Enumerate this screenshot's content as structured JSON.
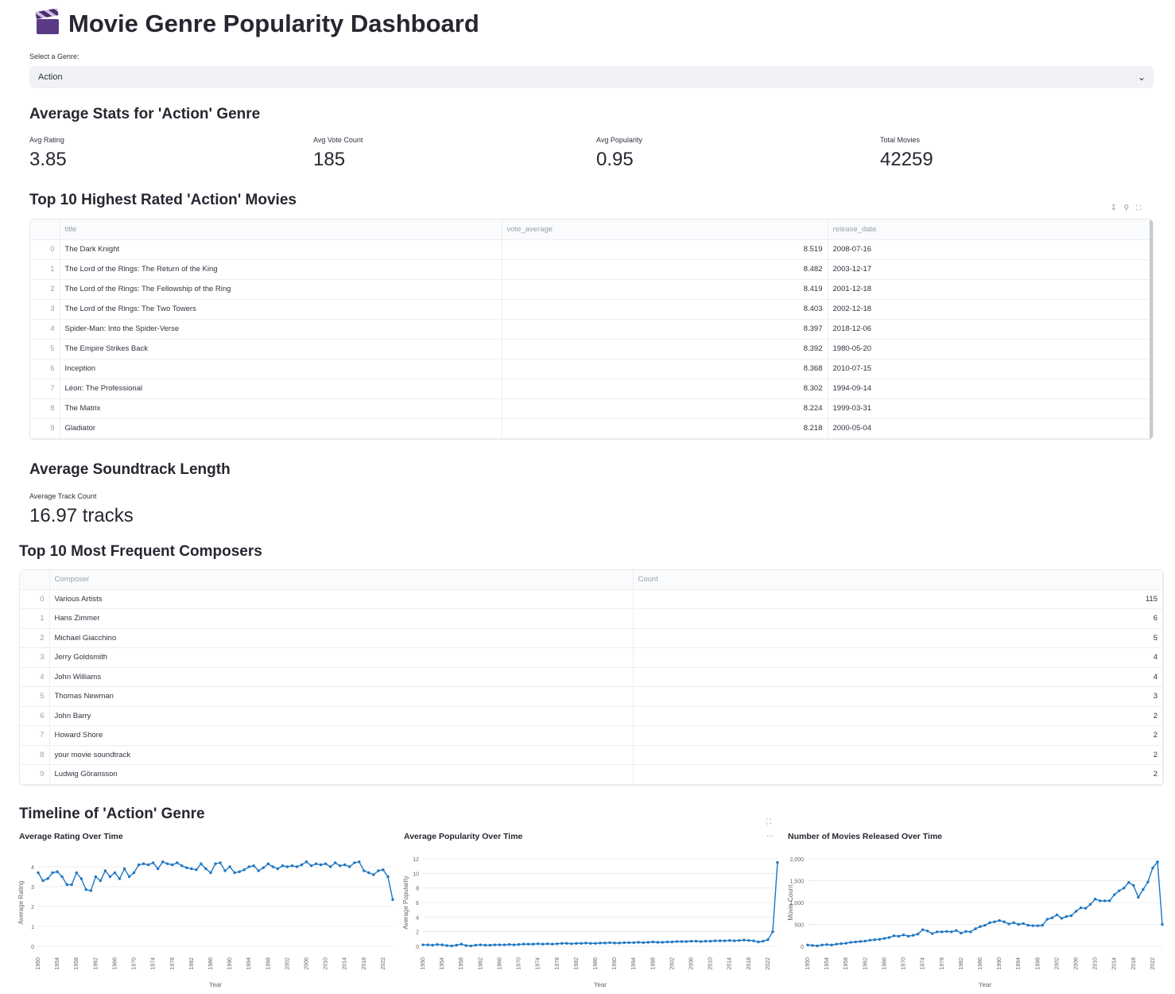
{
  "app": {
    "title": "Movie Genre Popularity Dashboard",
    "title_icon": "clapperboard-icon"
  },
  "genre_select": {
    "label": "Select a Genre:",
    "value": "Action"
  },
  "stats": {
    "heading": "Average Stats for 'Action' Genre",
    "metrics": [
      {
        "label": "Avg Rating",
        "value": "3.85"
      },
      {
        "label": "Avg Vote Count",
        "value": "185"
      },
      {
        "label": "Avg Popularity",
        "value": "0.95"
      },
      {
        "label": "Total Movies",
        "value": "42259"
      }
    ]
  },
  "top_movies": {
    "heading": "Top 10 Highest Rated 'Action' Movies",
    "toolbar_icons": [
      "download-icon",
      "search-icon",
      "fullscreen-icon"
    ],
    "columns": [
      "title",
      "vote_average",
      "release_date"
    ],
    "rows": [
      {
        "idx": "0",
        "title": "The Dark Knight",
        "vote_average": "8.519",
        "release_date": "2008-07-16"
      },
      {
        "idx": "1",
        "title": "The Lord of the Rings: The Return of the King",
        "vote_average": "8.482",
        "release_date": "2003-12-17"
      },
      {
        "idx": "2",
        "title": "The Lord of the Rings: The Fellowship of the Ring",
        "vote_average": "8.419",
        "release_date": "2001-12-18"
      },
      {
        "idx": "3",
        "title": "The Lord of the Rings: The Two Towers",
        "vote_average": "8.403",
        "release_date": "2002-12-18"
      },
      {
        "idx": "4",
        "title": "Spider-Man: Into the Spider-Verse",
        "vote_average": "8.397",
        "release_date": "2018-12-06"
      },
      {
        "idx": "5",
        "title": "The Empire Strikes Back",
        "vote_average": "8.392",
        "release_date": "1980-05-20"
      },
      {
        "idx": "6",
        "title": "Inception",
        "vote_average": "8.368",
        "release_date": "2010-07-15"
      },
      {
        "idx": "7",
        "title": "Léon: The Professional",
        "vote_average": "8.302",
        "release_date": "1994-09-14"
      },
      {
        "idx": "8",
        "title": "The Matrix",
        "vote_average": "8.224",
        "release_date": "1999-03-31"
      },
      {
        "idx": "9",
        "title": "Gladiator",
        "vote_average": "8.218",
        "release_date": "2000-05-04"
      }
    ]
  },
  "soundtrack": {
    "heading": "Average Soundtrack Length",
    "metric_label": "Average Track Count",
    "metric_value": "16.97 tracks"
  },
  "composers": {
    "heading": "Top 10 Most Frequent Composers",
    "columns": [
      "Composer",
      "Count"
    ],
    "rows": [
      {
        "idx": "0",
        "composer": "Various Artists",
        "count": "115"
      },
      {
        "idx": "1",
        "composer": "Hans Zimmer",
        "count": "6"
      },
      {
        "idx": "2",
        "composer": "Michael Giacchino",
        "count": "5"
      },
      {
        "idx": "3",
        "composer": "Jerry Goldsmith",
        "count": "4"
      },
      {
        "idx": "4",
        "composer": "John Williams",
        "count": "4"
      },
      {
        "idx": "5",
        "composer": "Thomas Newman",
        "count": "3"
      },
      {
        "idx": "6",
        "composer": "John Barry",
        "count": "2"
      },
      {
        "idx": "7",
        "composer": "Howard Shore",
        "count": "2"
      },
      {
        "idx": "8",
        "composer": "your movie soundtrack",
        "count": "2"
      },
      {
        "idx": "9",
        "composer": "Ludwig Göransson",
        "count": "2"
      }
    ]
  },
  "timeline": {
    "heading": "Timeline of 'Action' Genre",
    "line_color": "#1f77c4"
  },
  "chart_data": [
    {
      "type": "line",
      "title": "Average Rating Over Time",
      "xlabel": "Year",
      "ylabel": "Average Rating",
      "xlim": [
        1950,
        2024
      ],
      "ylim": [
        0,
        4.4
      ],
      "yticks": [
        0,
        1,
        2,
        3,
        4
      ],
      "xticks": [
        1950,
        1954,
        1958,
        1962,
        1966,
        1970,
        1974,
        1978,
        1982,
        1986,
        1990,
        1994,
        1998,
        2002,
        2006,
        2010,
        2014,
        2018,
        2022
      ],
      "x": [
        1950,
        1951,
        1952,
        1953,
        1954,
        1955,
        1956,
        1957,
        1958,
        1959,
        1960,
        1961,
        1962,
        1963,
        1964,
        1965,
        1966,
        1967,
        1968,
        1969,
        1970,
        1971,
        1972,
        1973,
        1974,
        1975,
        1976,
        1977,
        1978,
        1979,
        1980,
        1981,
        1982,
        1983,
        1984,
        1985,
        1986,
        1987,
        1988,
        1989,
        1990,
        1991,
        1992,
        1993,
        1994,
        1995,
        1996,
        1997,
        1998,
        1999,
        2000,
        2001,
        2002,
        2003,
        2004,
        2005,
        2006,
        2007,
        2008,
        2009,
        2010,
        2011,
        2012,
        2013,
        2014,
        2015,
        2016,
        2017,
        2018,
        2019,
        2020,
        2021,
        2022,
        2023,
        2024
      ],
      "y": [
        3.7,
        3.3,
        3.4,
        3.7,
        3.75,
        3.5,
        3.1,
        3.1,
        3.7,
        3.4,
        2.85,
        2.8,
        3.5,
        3.3,
        3.8,
        3.5,
        3.7,
        3.4,
        3.9,
        3.5,
        3.7,
        4.1,
        4.15,
        4.1,
        4.2,
        3.9,
        4.25,
        4.15,
        4.1,
        4.2,
        4.05,
        3.95,
        3.9,
        3.85,
        4.15,
        3.9,
        3.7,
        4.15,
        4.2,
        3.8,
        4.0,
        3.7,
        3.75,
        3.85,
        4.0,
        4.05,
        3.8,
        3.95,
        4.15,
        4.0,
        3.9,
        4.05,
        4.0,
        4.05,
        4.0,
        4.1,
        4.25,
        4.05,
        4.15,
        4.1,
        4.15,
        4.0,
        4.2,
        4.05,
        4.1,
        4.0,
        4.2,
        4.25,
        3.8,
        3.7,
        3.6,
        3.8,
        3.85,
        3.5,
        2.35
      ]
    },
    {
      "type": "line",
      "title": "Average Popularity Over Time",
      "xlabel": "Year",
      "ylabel": "Average Popularity",
      "xlim": [
        1950,
        2024
      ],
      "ylim": [
        0,
        12
      ],
      "yticks": [
        0,
        2,
        4,
        6,
        8,
        10,
        12
      ],
      "xticks": [
        1950,
        1954,
        1958,
        1962,
        1966,
        1970,
        1974,
        1978,
        1982,
        1986,
        1990,
        1994,
        1998,
        2002,
        2006,
        2010,
        2014,
        2018,
        2022
      ],
      "x": [
        1950,
        1951,
        1952,
        1953,
        1954,
        1955,
        1956,
        1957,
        1958,
        1959,
        1960,
        1961,
        1962,
        1963,
        1964,
        1965,
        1966,
        1967,
        1968,
        1969,
        1970,
        1971,
        1972,
        1973,
        1974,
        1975,
        1976,
        1977,
        1978,
        1979,
        1980,
        1981,
        1982,
        1983,
        1984,
        1985,
        1986,
        1987,
        1988,
        1989,
        1990,
        1991,
        1992,
        1993,
        1994,
        1995,
        1996,
        1997,
        1998,
        1999,
        2000,
        2001,
        2002,
        2003,
        2004,
        2005,
        2006,
        2007,
        2008,
        2009,
        2010,
        2011,
        2012,
        2013,
        2014,
        2015,
        2016,
        2017,
        2018,
        2019,
        2020,
        2021,
        2022,
        2023,
        2024
      ],
      "y": [
        0.2,
        0.2,
        0.15,
        0.25,
        0.2,
        0.1,
        0.05,
        0.15,
        0.3,
        0.1,
        0.05,
        0.15,
        0.2,
        0.15,
        0.15,
        0.2,
        0.2,
        0.2,
        0.25,
        0.2,
        0.25,
        0.3,
        0.3,
        0.3,
        0.35,
        0.3,
        0.35,
        0.3,
        0.35,
        0.4,
        0.4,
        0.35,
        0.4,
        0.4,
        0.45,
        0.4,
        0.4,
        0.45,
        0.45,
        0.5,
        0.45,
        0.45,
        0.5,
        0.5,
        0.5,
        0.55,
        0.5,
        0.55,
        0.6,
        0.55,
        0.55,
        0.6,
        0.6,
        0.65,
        0.65,
        0.65,
        0.7,
        0.7,
        0.65,
        0.7,
        0.7,
        0.75,
        0.75,
        0.75,
        0.8,
        0.75,
        0.8,
        0.85,
        0.8,
        0.75,
        0.6,
        0.7,
        0.9,
        2.0,
        11.5
      ]
    },
    {
      "type": "line",
      "title": "Number of Movies Released Over Time",
      "xlabel": "Year",
      "ylabel": "Movie Count",
      "xlim": [
        1950,
        2024
      ],
      "ylim": [
        0,
        2000
      ],
      "yticks": [
        0,
        500,
        1000,
        1500,
        2000
      ],
      "ytick_labels": [
        "0",
        "500",
        "1,000",
        "1,500",
        "2,000"
      ],
      "xticks": [
        1950,
        1954,
        1958,
        1962,
        1966,
        1970,
        1974,
        1978,
        1982,
        1986,
        1990,
        1994,
        1998,
        2002,
        2006,
        2010,
        2014,
        2018,
        2022
      ],
      "x": [
        1950,
        1951,
        1952,
        1953,
        1954,
        1955,
        1956,
        1957,
        1958,
        1959,
        1960,
        1961,
        1962,
        1963,
        1964,
        1965,
        1966,
        1967,
        1968,
        1969,
        1970,
        1971,
        1972,
        1973,
        1974,
        1975,
        1976,
        1977,
        1978,
        1979,
        1980,
        1981,
        1982,
        1983,
        1984,
        1985,
        1986,
        1987,
        1988,
        1989,
        1990,
        1991,
        1992,
        1993,
        1994,
        1995,
        1996,
        1997,
        1998,
        1999,
        2000,
        2001,
        2002,
        2003,
        2004,
        2005,
        2006,
        2007,
        2008,
        2009,
        2010,
        2011,
        2012,
        2013,
        2014,
        2015,
        2016,
        2017,
        2018,
        2019,
        2020,
        2021,
        2022,
        2023,
        2024
      ],
      "y": [
        30,
        20,
        10,
        30,
        40,
        30,
        50,
        60,
        70,
        90,
        100,
        110,
        120,
        140,
        150,
        160,
        180,
        200,
        240,
        230,
        260,
        230,
        250,
        280,
        380,
        350,
        290,
        330,
        330,
        340,
        330,
        360,
        300,
        340,
        330,
        400,
        450,
        480,
        540,
        560,
        590,
        560,
        510,
        540,
        500,
        520,
        480,
        470,
        470,
        480,
        620,
        650,
        720,
        640,
        680,
        700,
        800,
        880,
        870,
        960,
        1080,
        1040,
        1040,
        1040,
        1180,
        1270,
        1330,
        1460,
        1390,
        1120,
        1300,
        1470,
        1790,
        1930,
        500
      ]
    }
  ]
}
